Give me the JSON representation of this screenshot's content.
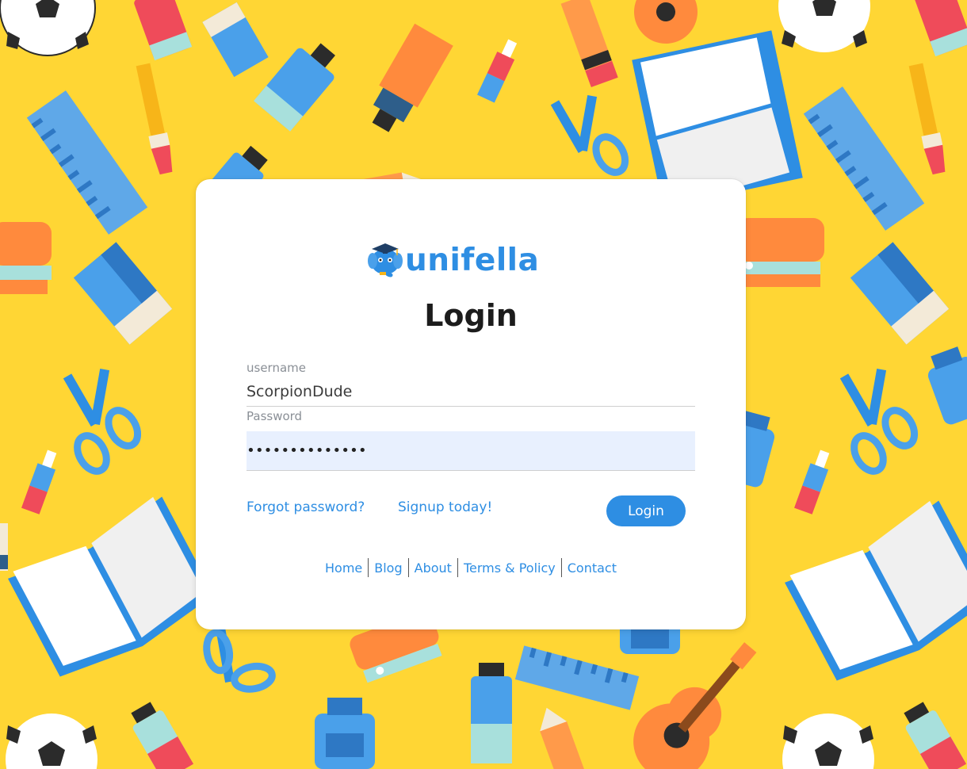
{
  "brand": {
    "name": "unifella",
    "color": "#2e8ee3",
    "logo_icon": "elephant-graduate-icon"
  },
  "background": {
    "color": "#ffd634",
    "pattern": "school-supplies-illustration"
  },
  "login_form": {
    "title": "Login",
    "username_label": "username",
    "username_value": "ScorpionDude",
    "password_label": "Password",
    "password_value": "••••••••••••••",
    "forgot_link": "Forgot password?",
    "signup_link": "Signup today!",
    "submit_label": "Login"
  },
  "footer": {
    "links": [
      "Home",
      "Blog",
      "About",
      "Terms & Policy",
      "Contact"
    ]
  }
}
